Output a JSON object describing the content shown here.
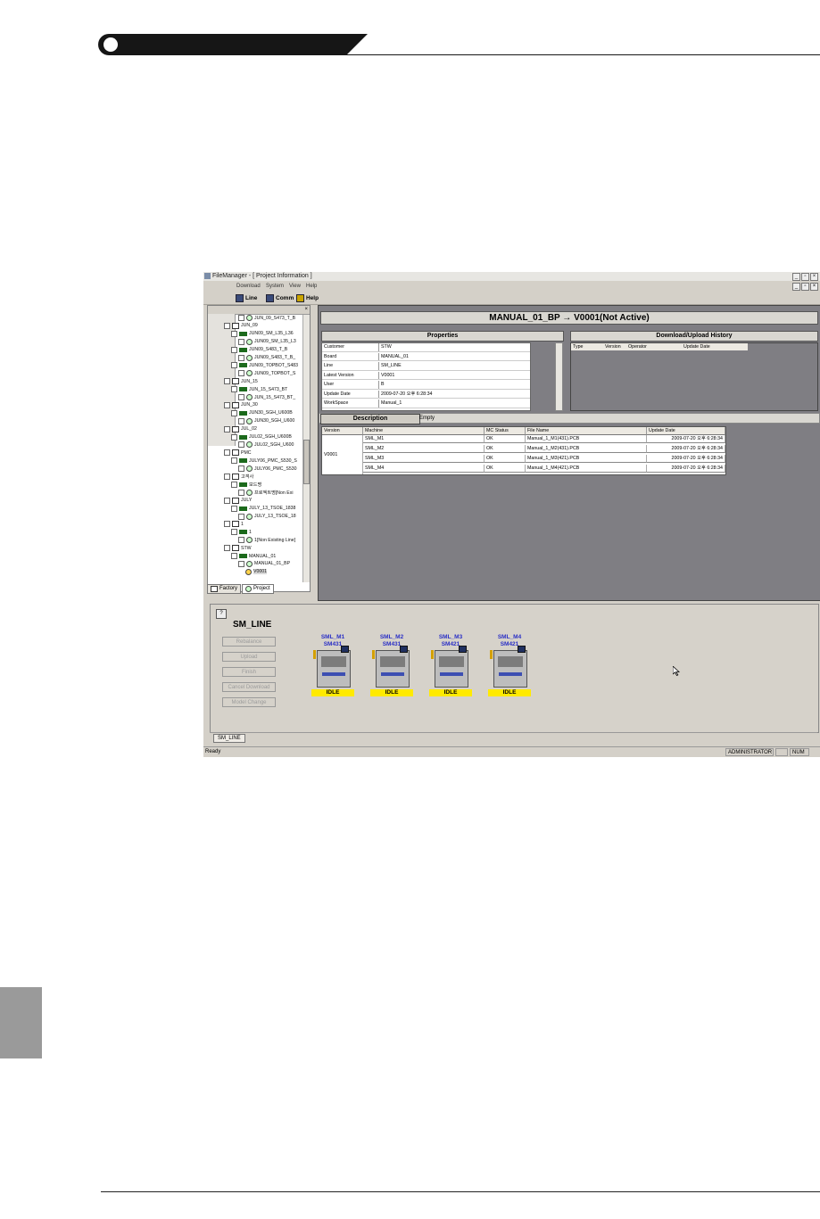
{
  "app": {
    "title": "FileManager - [ Project Information ]",
    "menu": [
      "Download",
      "System",
      "View",
      "Help"
    ],
    "window_buttons": [
      "_",
      "▫",
      "×"
    ],
    "toolbar": {
      "line": "Line",
      "comm": "Comm",
      "help": "Help"
    }
  },
  "tree": {
    "items": [
      {
        "label": "JUN_09_S473_T_B",
        "level": 2,
        "icon": "cog-icon"
      },
      {
        "label": "JUN_09",
        "level": 0,
        "icon": "folder-icon"
      },
      {
        "label": "JUN09_SM_L35_L36",
        "level": 1,
        "icon": "board-icon"
      },
      {
        "label": "JUN09_SM_L35_L3",
        "level": 2,
        "icon": "cog-icon"
      },
      {
        "label": "JUN09_S483_T_B",
        "level": 1,
        "icon": "board-icon"
      },
      {
        "label": "JUN09_S483_T_B_",
        "level": 2,
        "icon": "cog-icon"
      },
      {
        "label": "JUN09_TOPBOT_S483",
        "level": 1,
        "icon": "board-icon"
      },
      {
        "label": "JUN09_TOPBOT_S",
        "level": 2,
        "icon": "cog-icon"
      },
      {
        "label": "JUN_15",
        "level": 0,
        "icon": "folder-icon"
      },
      {
        "label": "JUN_15_S473_BT",
        "level": 1,
        "icon": "board-icon"
      },
      {
        "label": "JUN_15_S473_BT_",
        "level": 2,
        "icon": "cog-icon"
      },
      {
        "label": "JUN_30",
        "level": 0,
        "icon": "folder-icon"
      },
      {
        "label": "JUN30_SGH_U600B",
        "level": 1,
        "icon": "board-icon"
      },
      {
        "label": "JUN30_SGH_U600",
        "level": 2,
        "icon": "cog-icon"
      },
      {
        "label": "JUL_02",
        "level": 0,
        "icon": "folder-icon"
      },
      {
        "label": "JUL02_SGH_U600B",
        "level": 1,
        "icon": "board-icon"
      },
      {
        "label": "JUL02_SGH_U600",
        "level": 2,
        "icon": "cog-icon"
      },
      {
        "label": "PMC",
        "level": 0,
        "icon": "folder-icon"
      },
      {
        "label": "JULY06_PMC_S530_S",
        "level": 1,
        "icon": "board-icon"
      },
      {
        "label": "JULY06_PMC_S530",
        "level": 2,
        "icon": "cog-icon"
      },
      {
        "label": "고객사",
        "level": 0,
        "icon": "folder-icon"
      },
      {
        "label": "보드명",
        "level": 1,
        "icon": "board-icon"
      },
      {
        "label": "프로젝트명[Non Exi",
        "level": 2,
        "icon": "cog-icon"
      },
      {
        "label": "JULY",
        "level": 0,
        "icon": "folder-icon"
      },
      {
        "label": "JULY_13_TSOE_1838",
        "level": 1,
        "icon": "board-icon"
      },
      {
        "label": "JULY_13_TSOE_18",
        "level": 2,
        "icon": "cog-icon"
      },
      {
        "label": "1",
        "level": 0,
        "icon": "folder-icon"
      },
      {
        "label": "1",
        "level": 1,
        "icon": "board-icon"
      },
      {
        "label": "1[Non Existing Line]",
        "level": 2,
        "icon": "cog-icon"
      },
      {
        "label": "STW",
        "level": 0,
        "icon": "folder-icon"
      },
      {
        "label": "MANUAL_01",
        "level": 1,
        "icon": "board-icon"
      },
      {
        "label": "MANUAL_01_BP",
        "level": 2,
        "icon": "cog-icon"
      },
      {
        "label": "V0001",
        "level": 3,
        "icon": "version-icon"
      }
    ],
    "tabs": [
      "Factory",
      "Project"
    ]
  },
  "project": {
    "title": "MANUAL_01_BP → V0001(Not Active)",
    "properties_header": "Properties",
    "properties": [
      {
        "key": "Customer",
        "value": "STW"
      },
      {
        "key": "Board",
        "value": "MANUAL_01"
      },
      {
        "key": "Line",
        "value": "SM_LINE"
      },
      {
        "key": "Latest Version",
        "value": "V0001"
      },
      {
        "key": "User",
        "value": "B"
      },
      {
        "key": "Update Date",
        "value": "2009-07-20 오후 6:28:34"
      },
      {
        "key": "WorkSpace",
        "value": "Manual_1"
      }
    ],
    "history_header": "Download/Upload History",
    "history_columns": [
      "Type",
      "Version",
      "Operator",
      "Update Date"
    ],
    "description_label": "Description",
    "description_value": "Empty",
    "table_columns": [
      "Version",
      "Machine",
      "MC Status",
      "File Name",
      "Update Date"
    ],
    "version": "V0001",
    "rows": [
      {
        "machine": "SML_M1",
        "status": "OK",
        "file": "Manual_1_M1(431).PCB",
        "date": "2009-07-20 오후 6:28:34"
      },
      {
        "machine": "SML_M2",
        "status": "OK",
        "file": "Manual_1_M2(431).PCB",
        "date": "2009-07-20 오후 6:28:34"
      },
      {
        "machine": "SML_M3",
        "status": "OK",
        "file": "Manual_1_M3(421).PCB",
        "date": "2009-07-20 오후 6:28:34"
      },
      {
        "machine": "SML_M4",
        "status": "OK",
        "file": "Manual_1_M4(421).PCB",
        "date": "2009-07-20 오후 6:28:34"
      }
    ]
  },
  "line": {
    "help_button": "?",
    "title": "SM_LINE",
    "buttons": [
      "Rebalance",
      "Upload",
      "Finish",
      "Cancel Download",
      "Model Change"
    ],
    "machines": [
      {
        "name": "SML_M1",
        "model": "SM431",
        "status": "IDLE"
      },
      {
        "name": "SML_M2",
        "model": "SM431",
        "status": "IDLE"
      },
      {
        "name": "SML_M3",
        "model": "SM421",
        "status": "IDLE"
      },
      {
        "name": "SML_M4",
        "model": "SM421",
        "status": "IDLE"
      }
    ],
    "tab": "SM_LINE"
  },
  "status": {
    "text": "Ready",
    "user": "ADMINISTRATOR",
    "num": "NUM"
  }
}
